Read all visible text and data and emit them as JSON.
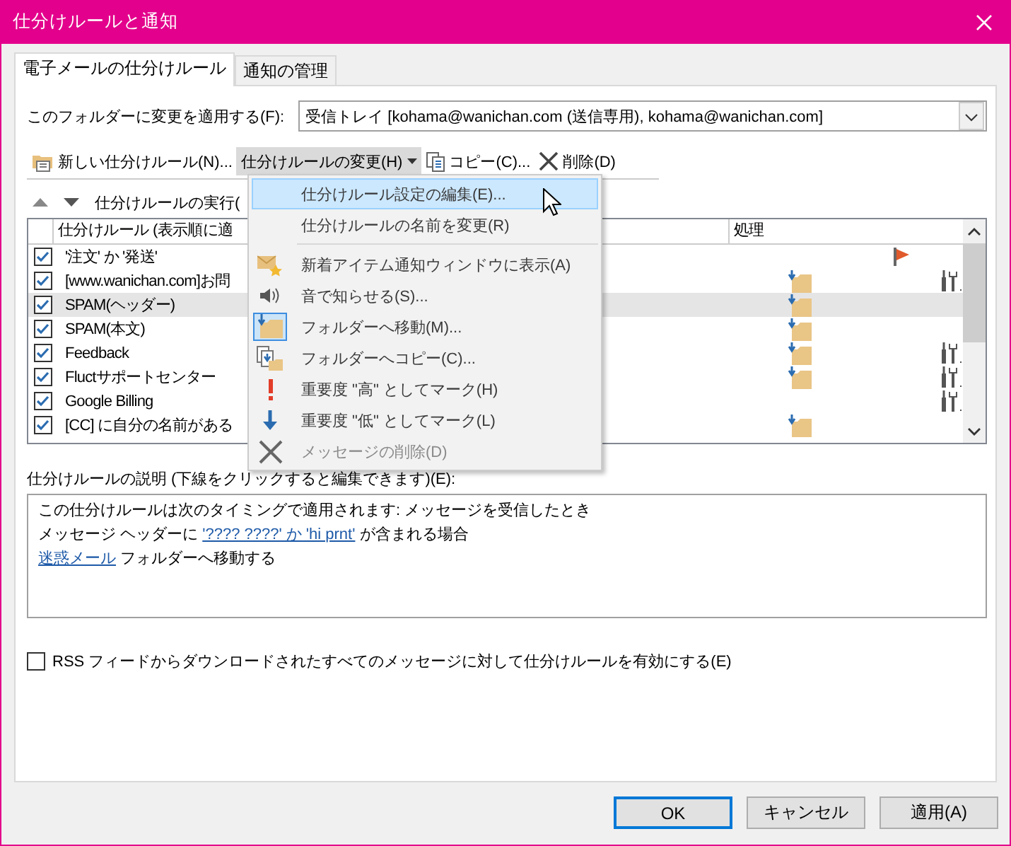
{
  "window": {
    "title": "仕分けルールと通知"
  },
  "tabs": [
    {
      "label": "電子メールの仕分けルール",
      "selected": true
    },
    {
      "label": "通知の管理",
      "selected": false
    }
  ],
  "folder": {
    "label": "このフォルダーに変更を適用する(F):",
    "value": "受信トレイ [kohama@wanichan.com (送信専用), kohama@wanichan.com]"
  },
  "toolbar": [
    {
      "kind": "new",
      "label": "新しい仕分けルール(N)...",
      "pressed": false
    },
    {
      "kind": "change",
      "label": "仕分けルールの変更(H)",
      "pressed": true
    },
    {
      "kind": "copy",
      "label": "コピー(C)...",
      "pressed": false
    },
    {
      "kind": "delete",
      "label": "削除(D)",
      "pressed": false
    }
  ],
  "run_label": "仕分けルールの実行(",
  "rules": {
    "columns": [
      "仕分けルール (表示順に適",
      "処理"
    ],
    "rows": [
      {
        "name": "'注文' か '発送'",
        "checked": true,
        "selected": false,
        "move": false,
        "flag": true,
        "tools": false
      },
      {
        "name": "[www.wanichan.com]お問",
        "checked": true,
        "selected": false,
        "move": true,
        "flag": false,
        "tools": true
      },
      {
        "name": "SPAM(ヘッダー)",
        "checked": true,
        "selected": true,
        "move": true,
        "flag": false,
        "tools": false
      },
      {
        "name": "SPAM(本文)",
        "checked": true,
        "selected": false,
        "move": true,
        "flag": false,
        "tools": false
      },
      {
        "name": "Feedback",
        "checked": true,
        "selected": false,
        "move": true,
        "flag": false,
        "tools": true
      },
      {
        "name": "Fluctサポートセンター",
        "checked": true,
        "selected": false,
        "move": true,
        "flag": false,
        "tools": true
      },
      {
        "name": "Google Billing",
        "checked": true,
        "selected": false,
        "move": false,
        "flag": false,
        "tools": true
      },
      {
        "name": "[CC] に自分の名前がある",
        "checked": true,
        "selected": false,
        "move": true,
        "flag": false,
        "tools": false
      }
    ]
  },
  "description": {
    "label": "仕分けルールの説明 (下線をクリックすると編集できます)(E):",
    "lines": [
      [
        {
          "text": "この仕分けルールは次のタイミングで適用されます: メッセージを受信したとき",
          "link": false
        }
      ],
      [
        {
          "text": "メッセージ ヘッダーに ",
          "link": false
        },
        {
          "text": "'???? ????' か 'hi prnt'",
          "link": true
        },
        {
          "text": " が含まれる場合",
          "link": false
        }
      ],
      [
        {
          "text": "迷惑メール",
          "link": true
        },
        {
          "text": " フォルダーへ移動する",
          "link": false
        }
      ]
    ]
  },
  "rss": {
    "label": "RSS フィードからダウンロードされたすべてのメッセージに対して仕分けルールを有効にする(E)",
    "checked": false
  },
  "buttons": [
    {
      "label": "OK",
      "default": true
    },
    {
      "label": "キャンセル",
      "default": false
    },
    {
      "label": "適用(A)",
      "default": false
    }
  ],
  "menu": {
    "items": [
      {
        "kind": "none",
        "label": "仕分けルール設定の編集(E)...",
        "selected": true,
        "disabled": false,
        "checked": false,
        "separator_after": false
      },
      {
        "kind": "none",
        "label": "仕分けルールの名前を変更(R)",
        "selected": false,
        "disabled": false,
        "checked": false,
        "separator_after": true
      },
      {
        "kind": "alert",
        "label": "新着アイテム通知ウィンドウに表示(A)",
        "selected": false,
        "disabled": false,
        "checked": false,
        "separator_after": false
      },
      {
        "kind": "sound",
        "label": "音で知らせる(S)...",
        "selected": false,
        "disabled": false,
        "checked": false,
        "separator_after": false
      },
      {
        "kind": "move",
        "label": "フォルダーへ移動(M)...",
        "selected": false,
        "disabled": false,
        "checked": true,
        "separator_after": false
      },
      {
        "kind": "copy",
        "label": "フォルダーへコピー(C)...",
        "selected": false,
        "disabled": false,
        "checked": false,
        "separator_after": false
      },
      {
        "kind": "high",
        "label": "重要度 \"高\" としてマーク(H)",
        "selected": false,
        "disabled": false,
        "checked": false,
        "separator_after": false
      },
      {
        "kind": "low",
        "label": "重要度 \"低\" としてマーク(L)",
        "selected": false,
        "disabled": false,
        "checked": false,
        "separator_after": false
      },
      {
        "kind": "delete",
        "label": "メッセージの削除(D)",
        "selected": false,
        "disabled": true,
        "checked": false,
        "separator_after": false
      }
    ]
  }
}
